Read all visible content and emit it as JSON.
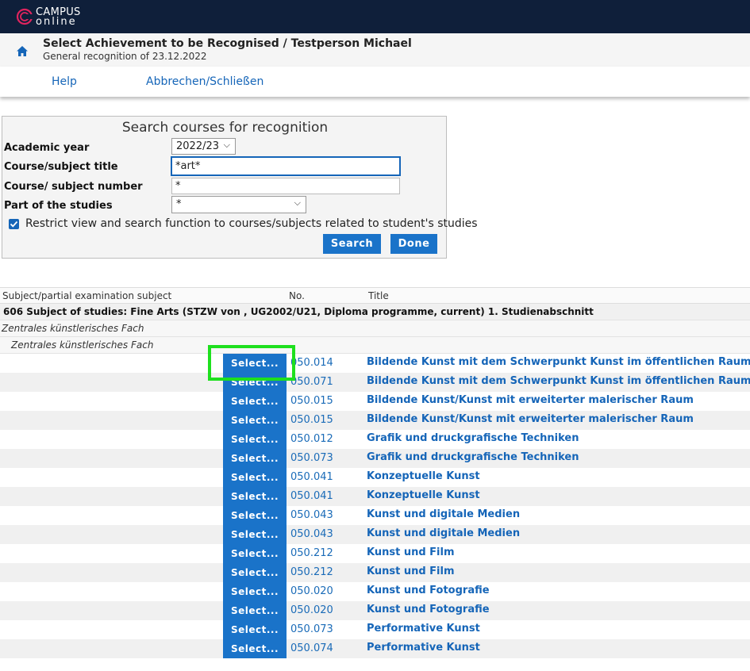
{
  "app": {
    "logo_line1": "CAMPUS",
    "logo_line2": "online"
  },
  "header": {
    "title": "Select Achievement to be Recognised  / Testperson Michael",
    "subtitle": "General recognition of 23.12.2022"
  },
  "nav": {
    "help": "Help",
    "cancel_close": "Abbrechen/Schließen"
  },
  "search": {
    "title": "Search courses for recognition",
    "academic_year_label": "Academic year",
    "academic_year_value": "2022/23",
    "title_label": "Course/subject title",
    "title_value": "*art*",
    "number_label": "Course/ subject number",
    "number_value": "*",
    "part_label": "Part of the studies",
    "part_value": "*",
    "restrict_label": "Restrict view and search function to courses/subjects related to student's studies",
    "restrict_checked": true,
    "search_button": "Search",
    "done_button": "Done"
  },
  "table": {
    "headers": [
      "Subject/partial examination subject",
      "No.",
      "Title"
    ],
    "group1": "606 Subject of studies: Fine Arts (STZW von , UG2002/U21, Diploma programme, current) 1. Studienabschnitt",
    "group2": "Zentrales künstlerisches Fach",
    "group3": "Zentrales künstlerisches Fach",
    "select_label": "Select...",
    "rows": [
      {
        "no": "050.014",
        "title": "Bildende Kunst mit dem Schwerpunkt Kunst im öffentlichen Raum"
      },
      {
        "no": "050.071",
        "title": "Bildende Kunst mit dem Schwerpunkt Kunst im öffentlichen Raum"
      },
      {
        "no": "050.015",
        "title": "Bildende Kunst/Kunst mit erweiterter malerischer Raum"
      },
      {
        "no": "050.015",
        "title": "Bildende Kunst/Kunst mit erweiterter malerischer Raum"
      },
      {
        "no": "050.012",
        "title": "Grafik und druckgrafische Techniken"
      },
      {
        "no": "050.073",
        "title": "Grafik und druckgrafische Techniken"
      },
      {
        "no": "050.041",
        "title": "Konzeptuelle Kunst"
      },
      {
        "no": "050.041",
        "title": "Konzeptuelle Kunst"
      },
      {
        "no": "050.043",
        "title": "Kunst und digitale Medien"
      },
      {
        "no": "050.043",
        "title": "Kunst und digitale Medien"
      },
      {
        "no": "050.212",
        "title": "Kunst und Film"
      },
      {
        "no": "050.212",
        "title": "Kunst und Film"
      },
      {
        "no": "050.020",
        "title": "Kunst und Fotografie"
      },
      {
        "no": "050.020",
        "title": "Kunst und Fotografie"
      },
      {
        "no": "050.073",
        "title": "Performative Kunst"
      },
      {
        "no": "050.074",
        "title": "Performative Kunst"
      }
    ]
  },
  "colors": {
    "topbar": "#0f1f3a",
    "accent": "#1a73c9",
    "link": "#1565b8",
    "highlight": "#1ee01e"
  }
}
